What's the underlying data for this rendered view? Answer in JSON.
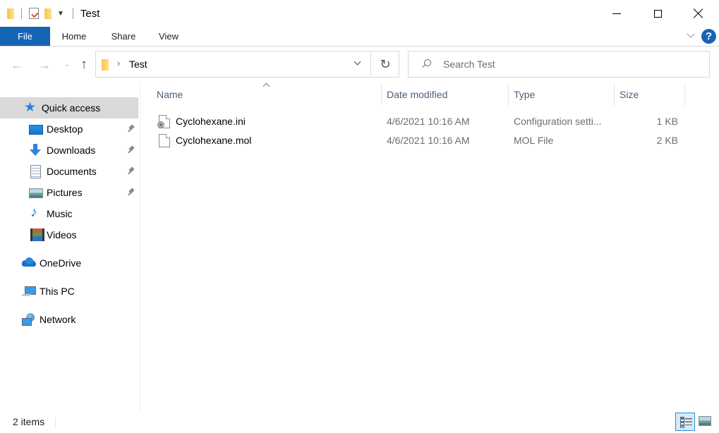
{
  "window": {
    "title": "Test",
    "controls": {
      "minimize": "minimize",
      "maximize": "maximize",
      "close": "close"
    }
  },
  "quick_access_toolbar": {
    "icons": [
      "folder-icon",
      "properties-icon",
      "new-folder-icon",
      "customize-dropdown-icon"
    ]
  },
  "ribbon": {
    "tabs": [
      {
        "label": "File",
        "active": true
      },
      {
        "label": "Home"
      },
      {
        "label": "Share"
      },
      {
        "label": "View"
      }
    ],
    "help_label": "?",
    "accent_color": "#1565b7"
  },
  "navigation": {
    "back_glyph": "←",
    "forward_glyph": "→",
    "recent_glyph": "⌄",
    "up_glyph": "↑",
    "address": {
      "breadcrumb": [
        "Test"
      ],
      "separator": "›"
    },
    "refresh_glyph": "↻",
    "search": {
      "placeholder": "Search Test",
      "value": ""
    }
  },
  "sidebar": {
    "items": [
      {
        "label": "Quick access",
        "icon": "quick-access-star-icon",
        "selected": true,
        "pinned": false
      },
      {
        "label": "Desktop",
        "icon": "desktop-icon",
        "pinned": true
      },
      {
        "label": "Downloads",
        "icon": "downloads-icon",
        "pinned": true
      },
      {
        "label": "Documents",
        "icon": "documents-icon",
        "pinned": true
      },
      {
        "label": "Pictures",
        "icon": "pictures-icon",
        "pinned": true
      },
      {
        "label": "Music",
        "icon": "music-icon",
        "pinned": false
      },
      {
        "label": "Videos",
        "icon": "videos-icon",
        "pinned": false
      },
      {
        "label": "OneDrive",
        "icon": "onedrive-icon"
      },
      {
        "label": "This PC",
        "icon": "this-pc-icon"
      },
      {
        "label": "Network",
        "icon": "network-icon"
      }
    ]
  },
  "file_list": {
    "columns": [
      {
        "label": "Name",
        "sorted": "ascending"
      },
      {
        "label": "Date modified"
      },
      {
        "label": "Type"
      },
      {
        "label": "Size"
      }
    ],
    "rows": [
      {
        "name": "Cyclohexane.ini",
        "icon": "config-file-icon",
        "date_modified": "4/6/2021 10:16 AM",
        "type": "Configuration setti...",
        "size": "1 KB"
      },
      {
        "name": "Cyclohexane.mol",
        "icon": "generic-file-icon",
        "date_modified": "4/6/2021 10:16 AM",
        "type": "MOL File",
        "size": "2 KB"
      }
    ]
  },
  "status_bar": {
    "item_count": "2 items",
    "view_modes": [
      "details",
      "large-icons"
    ],
    "active_view": "details"
  }
}
